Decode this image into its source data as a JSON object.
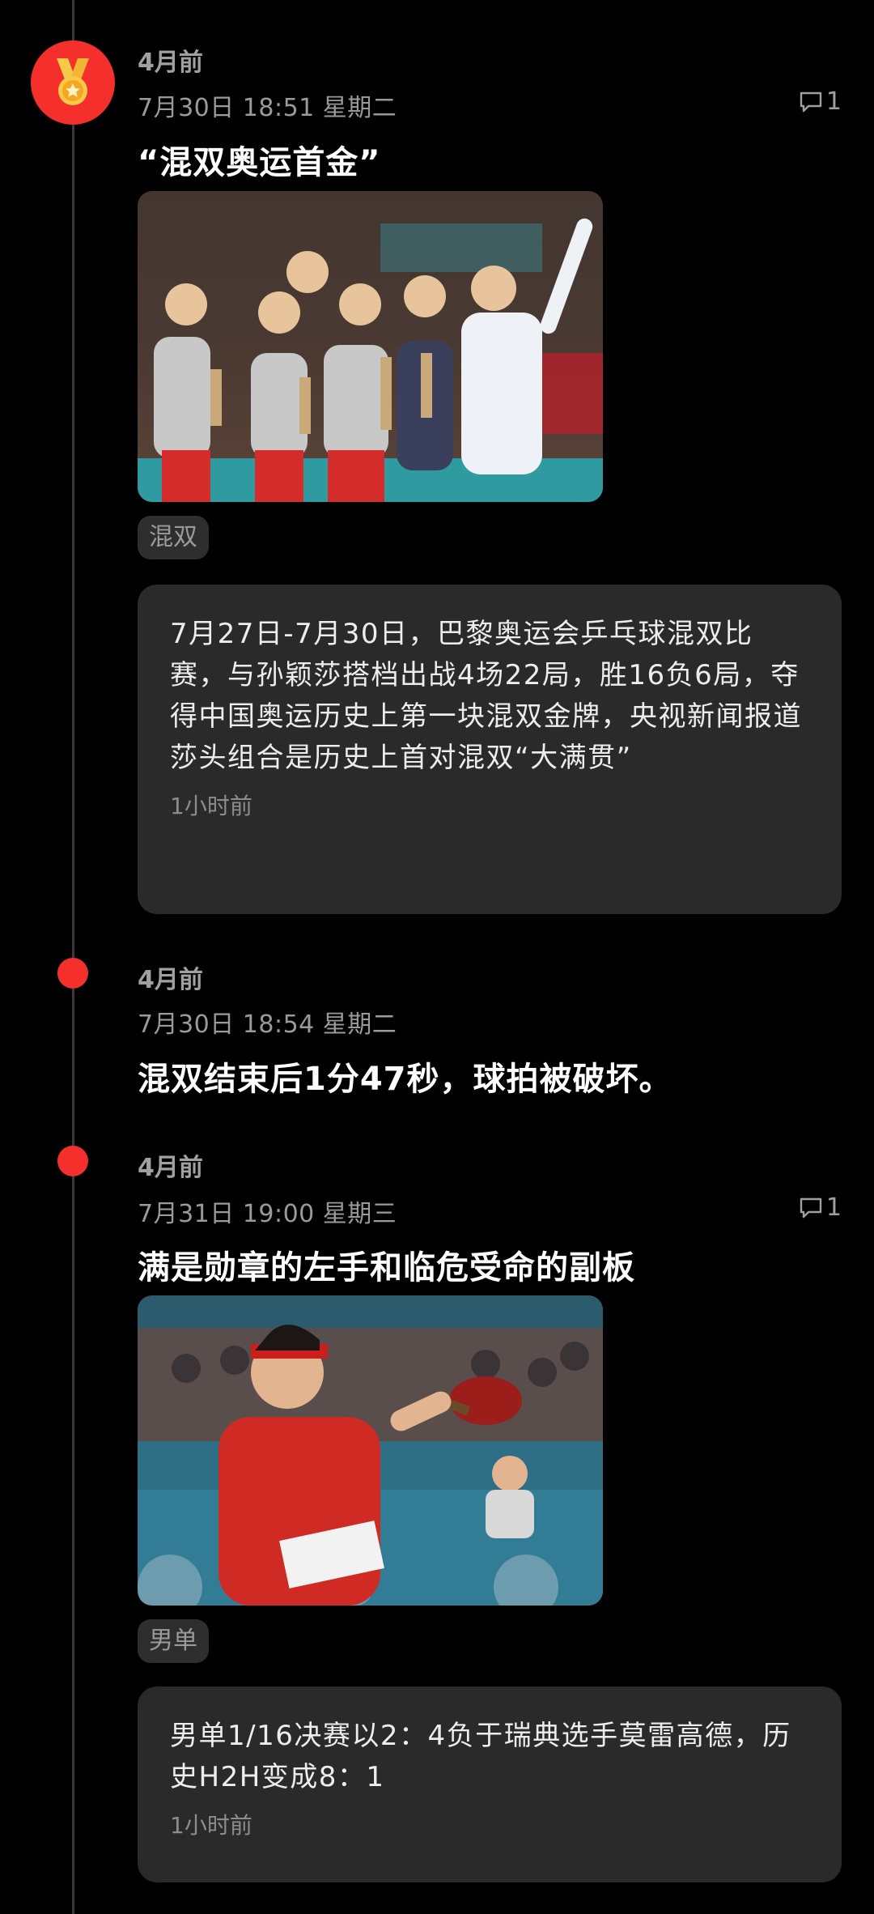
{
  "colors": {
    "accent": "#f5302c",
    "background": "#000000",
    "card": "#2a2a2a"
  },
  "entries": [
    {
      "ago": "4月前",
      "datetime": "7月30日 18:51 星期二",
      "comment_count": "1",
      "title": "“混双奥运首金”",
      "tag": "混双",
      "note": "7月27日-7月30日，巴黎奥运会乒乓球混双比赛，与孙颖莎搭档出战4场22局，胜16负6局，夺得中国奥运历史上第一块混双金牌，央视新闻报道莎头组合是历史上首对混双“大满贯”",
      "note_time": "1小时前",
      "icon": "medal-icon"
    },
    {
      "ago": "4月前",
      "datetime": "7月30日 18:54 星期二",
      "title": "混双结束后1分47秒，球拍被破坏。"
    },
    {
      "ago": "4月前",
      "datetime": "7月31日 19:00 星期三",
      "comment_count": "1",
      "title": "满是勋章的左手和临危受命的副板",
      "tag": "男单",
      "note": "男单1/16决赛以2：4负于瑞典选手莫雷高德，历史H2H变成8：1",
      "note_time": "1小时前"
    }
  ]
}
